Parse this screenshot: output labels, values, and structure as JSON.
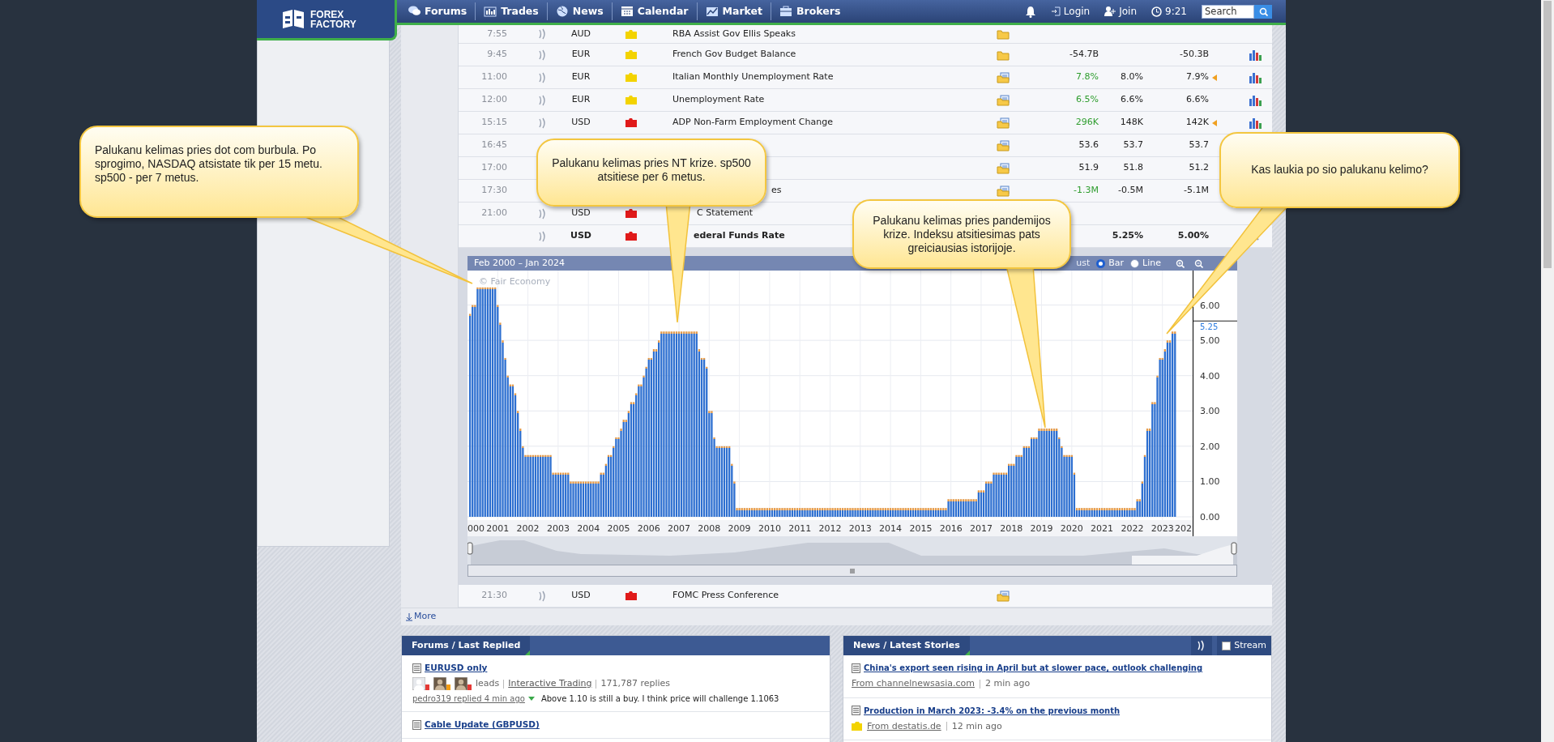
{
  "header": {
    "logo": "FOREX FACTORY",
    "nav": [
      {
        "label": "Forums",
        "kind": "forums"
      },
      {
        "label": "Trades",
        "kind": "trades"
      },
      {
        "label": "News",
        "kind": "news"
      },
      {
        "label": "Calendar",
        "kind": "calendar"
      },
      {
        "label": "Market",
        "kind": "market"
      },
      {
        "label": "Brokers",
        "kind": "brokers"
      }
    ],
    "login": "Login",
    "join": "Join",
    "time": "9:21",
    "search": {
      "placeholder": "Search"
    }
  },
  "calendar": {
    "rows": [
      {
        "time": "7:55",
        "currency": "AUD",
        "color": "#f3d300",
        "event": "RBA Assist Gov Ellis Speaks",
        "bold": false,
        "report": false
      },
      {
        "time": "9:45",
        "currency": "EUR",
        "color": "#f3d300",
        "event": "French Gov Budget Balance",
        "bold": false,
        "report": false,
        "actual": "-54.7B",
        "better": false,
        "previous": "-50.3B",
        "revised": false,
        "graph": true
      },
      {
        "time": "11:00",
        "currency": "EUR",
        "color": "#f3d300",
        "event": "Italian Monthly Unemployment Rate",
        "bold": false,
        "report": true,
        "actual": "7.8%",
        "better": true,
        "forecast": "8.0%",
        "previous": "7.9%",
        "revised": true,
        "graph": true
      },
      {
        "time": "12:00",
        "currency": "EUR",
        "color": "#f3d300",
        "event": "Unemployment Rate",
        "bold": false,
        "report": true,
        "actual": "6.5%",
        "better": true,
        "forecast": "6.6%",
        "previous": "6.6%",
        "revised": false,
        "graph": true
      },
      {
        "time": "15:15",
        "currency": "USD",
        "color": "#e01a1a",
        "event": "ADP Non-Farm Employment Change",
        "bold": false,
        "report": true,
        "actual": "296K",
        "better": true,
        "forecast": "148K",
        "previous": "142K",
        "revised": true,
        "graph": true
      },
      {
        "time": "16:45",
        "bold": false,
        "report": true,
        "actual": "53.6",
        "better": false,
        "forecast": "53.7",
        "previous": "53.7",
        "revised": false
      },
      {
        "time": "17:00",
        "bold": false,
        "report": true,
        "actual": "51.9",
        "better": false,
        "forecast": "51.8",
        "previous": "51.2",
        "revised": false
      },
      {
        "time": "17:30",
        "event": "es",
        "bold": false,
        "report": true,
        "actual": "-1.3M",
        "better": true,
        "forecast": "-0.5M",
        "previous": "-5.1M",
        "revised": false
      },
      {
        "time": "21:00",
        "currency": "USD",
        "color": "#e01a1a",
        "event": "C Statement",
        "bold": false
      },
      {
        "currency": "USD",
        "color": "#e01a1a",
        "event": "ederal Funds Rate",
        "bold": true,
        "forecast": "5.25%",
        "previous": "5.00%",
        "revised": false,
        "dismissible": true
      }
    ],
    "chart": {
      "credit": "© Fair Economy",
      "option_fragment": "ust",
      "edge_labels": [
        "000",
        "202"
      ],
      "modes": [
        {
          "label": "Bar",
          "selected": true
        },
        {
          "label": "Line",
          "selected": false
        }
      ],
      "chart_data": {
        "type": "bar",
        "title": "Feb 2000 – Jan 2024",
        "xlim": [
          2000,
          2024
        ],
        "ylim": [
          0,
          7
        ],
        "grid": true,
        "x": [
          2000.083,
          2000.167,
          2000.25,
          2000.333,
          2000.417,
          2000.5,
          2000.583,
          2000.667,
          2000.75,
          2000.833,
          2000.917,
          2001,
          2001.083,
          2001.167,
          2001.25,
          2001.333,
          2001.417,
          2001.5,
          2001.583,
          2001.667,
          2001.75,
          2001.833,
          2001.917,
          2002,
          2002.083,
          2002.167,
          2002.25,
          2002.333,
          2002.417,
          2002.5,
          2002.583,
          2002.667,
          2002.75,
          2002.833,
          2002.917,
          2003,
          2003.083,
          2003.167,
          2003.25,
          2003.333,
          2003.417,
          2003.5,
          2003.583,
          2003.667,
          2003.75,
          2003.833,
          2003.917,
          2004,
          2004.083,
          2004.167,
          2004.25,
          2004.333,
          2004.417,
          2004.5,
          2004.583,
          2004.667,
          2004.75,
          2004.833,
          2004.917,
          2005,
          2005.083,
          2005.167,
          2005.25,
          2005.333,
          2005.417,
          2005.5,
          2005.583,
          2005.667,
          2005.75,
          2005.833,
          2005.917,
          2006,
          2006.083,
          2006.167,
          2006.25,
          2006.333,
          2006.417,
          2006.5,
          2006.583,
          2006.667,
          2006.75,
          2006.833,
          2006.917,
          2007,
          2007.083,
          2007.167,
          2007.25,
          2007.333,
          2007.417,
          2007.5,
          2007.583,
          2007.667,
          2007.75,
          2007.833,
          2007.917,
          2008,
          2008.083,
          2008.167,
          2008.25,
          2008.333,
          2008.417,
          2008.5,
          2008.583,
          2008.667,
          2008.75,
          2008.833,
          2008.917,
          2009,
          2009.083,
          2009.167,
          2009.25,
          2009.333,
          2009.417,
          2009.5,
          2009.583,
          2009.667,
          2009.75,
          2009.833,
          2009.917,
          2010,
          2010.083,
          2010.167,
          2010.25,
          2010.333,
          2010.417,
          2010.5,
          2010.583,
          2010.667,
          2010.75,
          2010.833,
          2010.917,
          2011,
          2011.083,
          2011.167,
          2011.25,
          2011.333,
          2011.417,
          2011.5,
          2011.583,
          2011.667,
          2011.75,
          2011.833,
          2011.917,
          2012,
          2012.083,
          2012.167,
          2012.25,
          2012.333,
          2012.417,
          2012.5,
          2012.583,
          2012.667,
          2012.75,
          2012.833,
          2012.917,
          2013,
          2013.083,
          2013.167,
          2013.25,
          2013.333,
          2013.417,
          2013.5,
          2013.583,
          2013.667,
          2013.75,
          2013.833,
          2013.917,
          2014,
          2014.083,
          2014.167,
          2014.25,
          2014.333,
          2014.417,
          2014.5,
          2014.583,
          2014.667,
          2014.75,
          2014.833,
          2014.917,
          2015,
          2015.083,
          2015.167,
          2015.25,
          2015.333,
          2015.417,
          2015.5,
          2015.583,
          2015.667,
          2015.75,
          2015.833,
          2015.917,
          2016,
          2016.083,
          2016.167,
          2016.25,
          2016.333,
          2016.417,
          2016.5,
          2016.583,
          2016.667,
          2016.75,
          2016.833,
          2016.917,
          2017,
          2017.083,
          2017.167,
          2017.25,
          2017.333,
          2017.417,
          2017.5,
          2017.583,
          2017.667,
          2017.75,
          2017.833,
          2017.917,
          2018,
          2018.083,
          2018.167,
          2018.25,
          2018.333,
          2018.417,
          2018.5,
          2018.583,
          2018.667,
          2018.75,
          2018.833,
          2018.917,
          2019,
          2019.083,
          2019.167,
          2019.25,
          2019.333,
          2019.417,
          2019.5,
          2019.583,
          2019.667,
          2019.75,
          2019.833,
          2019.917,
          2020,
          2020.083,
          2020.167,
          2020.25,
          2020.333,
          2020.417,
          2020.5,
          2020.583,
          2020.667,
          2020.75,
          2020.833,
          2020.917,
          2021,
          2021.083,
          2021.167,
          2021.25,
          2021.333,
          2021.417,
          2021.5,
          2021.583,
          2021.667,
          2021.75,
          2021.833,
          2021.917,
          2022,
          2022.083,
          2022.167,
          2022.25,
          2022.333,
          2022.417,
          2022.5,
          2022.583,
          2022.667,
          2022.75,
          2022.833,
          2022.917,
          2023,
          2023.083,
          2023.167,
          2023.25,
          2023.333,
          2023.417
        ],
        "values": [
          5.75,
          6,
          6,
          6.5,
          6.5,
          6.5,
          6.5,
          6.5,
          6.5,
          6.5,
          6.5,
          6,
          5.5,
          5,
          4.5,
          4,
          3.75,
          3.75,
          3.5,
          3,
          2.5,
          2,
          1.75,
          1.75,
          1.75,
          1.75,
          1.75,
          1.75,
          1.75,
          1.75,
          1.75,
          1.75,
          1.75,
          1.25,
          1.25,
          1.25,
          1.25,
          1.25,
          1.25,
          1.25,
          1,
          1,
          1,
          1,
          1,
          1,
          1,
          1,
          1,
          1,
          1,
          1,
          1.25,
          1.25,
          1.5,
          1.75,
          1.75,
          2,
          2.25,
          2.25,
          2.5,
          2.75,
          2.75,
          3,
          3.25,
          3.25,
          3.5,
          3.75,
          3.75,
          4,
          4.25,
          4.5,
          4.5,
          4.75,
          4.75,
          5,
          5.25,
          5.25,
          5.25,
          5.25,
          5.25,
          5.25,
          5.25,
          5.25,
          5.25,
          5.25,
          5.25,
          5.25,
          5.25,
          5.25,
          5.25,
          4.75,
          4.5,
          4.5,
          4.25,
          3,
          3,
          2.25,
          2,
          2,
          2,
          2,
          2,
          2,
          1.5,
          1,
          0.25,
          0.25,
          0.25,
          0.25,
          0.25,
          0.25,
          0.25,
          0.25,
          0.25,
          0.25,
          0.25,
          0.25,
          0.25,
          0.25,
          0.25,
          0.25,
          0.25,
          0.25,
          0.25,
          0.25,
          0.25,
          0.25,
          0.25,
          0.25,
          0.25,
          0.25,
          0.25,
          0.25,
          0.25,
          0.25,
          0.25,
          0.25,
          0.25,
          0.25,
          0.25,
          0.25,
          0.25,
          0.25,
          0.25,
          0.25,
          0.25,
          0.25,
          0.25,
          0.25,
          0.25,
          0.25,
          0.25,
          0.25,
          0.25,
          0.25,
          0.25,
          0.25,
          0.25,
          0.25,
          0.25,
          0.25,
          0.25,
          0.25,
          0.25,
          0.25,
          0.25,
          0.25,
          0.25,
          0.25,
          0.25,
          0.25,
          0.25,
          0.25,
          0.25,
          0.25,
          0.25,
          0.25,
          0.25,
          0.25,
          0.25,
          0.25,
          0.25,
          0.25,
          0.25,
          0.25,
          0.25,
          0.25,
          0.25,
          0.25,
          0.5,
          0.5,
          0.5,
          0.5,
          0.5,
          0.5,
          0.5,
          0.5,
          0.5,
          0.5,
          0.5,
          0.5,
          0.75,
          0.75,
          0.75,
          1,
          1,
          1,
          1.25,
          1.25,
          1.25,
          1.25,
          1.25,
          1.25,
          1.5,
          1.5,
          1.5,
          1.75,
          1.75,
          1.75,
          2,
          2,
          2,
          2.25,
          2.25,
          2.25,
          2.5,
          2.5,
          2.5,
          2.5,
          2.5,
          2.5,
          2.5,
          2.5,
          2.25,
          2,
          1.75,
          1.75,
          1.75,
          1.75,
          1.25,
          0.25,
          0.25,
          0.25,
          0.25,
          0.25,
          0.25,
          0.25,
          0.25,
          0.25,
          0.25,
          0.25,
          0.25,
          0.25,
          0.25,
          0.25,
          0.25,
          0.25,
          0.25,
          0.25,
          0.25,
          0.25,
          0.25,
          0.25,
          0.25,
          0.5,
          0.5,
          1,
          1.75,
          2.5,
          2.5,
          3.25,
          3.25,
          4,
          4.5,
          4.5,
          4.75,
          5,
          5,
          5.25,
          5.25
        ],
        "yticks": [
          {
            "value": 0,
            "label": "0.00"
          },
          {
            "value": 1,
            "label": "1.00"
          },
          {
            "value": 2,
            "label": "2.00"
          },
          {
            "value": 3,
            "label": "3.00"
          },
          {
            "value": 4,
            "label": "4.00"
          },
          {
            "value": 5,
            "label": "5.00"
          },
          {
            "value": 6,
            "label": "6.00"
          }
        ],
        "xticks": [
          {
            "value": 2001,
            "label": "2001"
          },
          {
            "value": 2002,
            "label": "2002"
          },
          {
            "value": 2003,
            "label": "2003"
          },
          {
            "value": 2004,
            "label": "2004"
          },
          {
            "value": 2005,
            "label": "2005"
          },
          {
            "value": 2006,
            "label": "2006"
          },
          {
            "value": 2007,
            "label": "2007"
          },
          {
            "value": 2008,
            "label": "2008"
          },
          {
            "value": 2009,
            "label": "2009"
          },
          {
            "value": 2010,
            "label": "2010"
          },
          {
            "value": 2011,
            "label": "2011"
          },
          {
            "value": 2012,
            "label": "2012"
          },
          {
            "value": 2013,
            "label": "2013"
          },
          {
            "value": 2014,
            "label": "2014"
          },
          {
            "value": 2015,
            "label": "2015"
          },
          {
            "value": 2016,
            "label": "2016"
          },
          {
            "value": 2017,
            "label": "2017"
          },
          {
            "value": 2018,
            "label": "2018"
          },
          {
            "value": 2019,
            "label": "2019"
          },
          {
            "value": 2020,
            "label": "2020"
          },
          {
            "value": 2021,
            "label": "2021"
          },
          {
            "value": 2022,
            "label": "2022"
          },
          {
            "value": 2023,
            "label": "2023"
          }
        ],
        "annotations": [
          "5.25"
        ]
      }
    },
    "rows_after": [
      {
        "time": "21:30",
        "currency": "USD",
        "color": "#e01a1a",
        "event": "FOMC Press Conference",
        "bold": false,
        "report": true
      }
    ],
    "more": "More"
  },
  "forums": {
    "title": "Forums / Last Replied",
    "threads": [
      {
        "title": "EURUSD only",
        "participants": [
          {
            "kind": "default",
            "color": "#e53935"
          },
          {
            "kind": "photo",
            "color": "#f39c12"
          },
          {
            "kind": "photo",
            "color": "#e53935"
          }
        ],
        "status": "leads",
        "forum": "Interactive Trading",
        "replies": "171,787 replies",
        "last_reply": "pedro319 replied 4 min ago",
        "preview": "Above 1.10 is still a buy. I think price will challenge 1.1063"
      },
      {
        "title": "Cable Update (GBPUSD)"
      }
    ]
  },
  "news": {
    "title": "News / Latest Stories",
    "stream": {
      "label": "Stream",
      "checked": false
    },
    "stories": [
      {
        "title": "China's export seen rising in April but at slower pace, outlook challenging",
        "source": "From channelnewsasia.com",
        "kind": "plain",
        "age": "2 min ago"
      },
      {
        "title": "Production in March 2023: -3.4% on the previous month",
        "source": "From destatis.de",
        "kind": "folder",
        "age": "12 min ago"
      }
    ]
  },
  "callouts": [
    {
      "text": "Palukanu kelimas pries dot com burbula. Po sprogimo, NASDAQ atsistate tik per 15 metu. sp500 - per 7 metus."
    },
    {
      "text": "Palukanu kelimas pries NT krize. sp500 atsitiese per 6 metus."
    },
    {
      "text": "Palukanu kelimas pries pandemijos krize. Indeksu atsitiesimas pats greiciausias istorijoje."
    },
    {
      "text": "Kas laukia po sio palukanu kelimo?"
    }
  ]
}
